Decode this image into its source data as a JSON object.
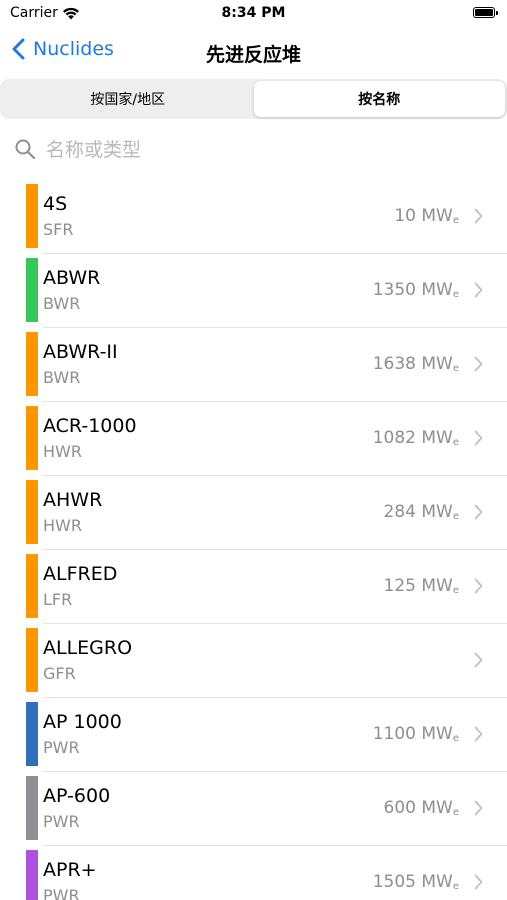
{
  "status_bar": {
    "carrier": "Carrier",
    "time": "8:34 PM"
  },
  "nav": {
    "back_label": "Nuclides",
    "title": "先进反应堆"
  },
  "segments": [
    {
      "label": "按国家/地区",
      "selected": false
    },
    {
      "label": "按名称",
      "selected": true
    }
  ],
  "search": {
    "placeholder": "名称或类型",
    "value": ""
  },
  "colors": {
    "accent": "#1f7ae0",
    "SFR": "#ff9500",
    "BWR": "#34c759",
    "HWR": "#ff9500",
    "LFR": "#ff9500",
    "GFR": "#ff9500",
    "PWR_blue": "#2f70b8",
    "PWR_gray": "#8e8e93",
    "PWR_purple": "#af52de"
  },
  "reactors": [
    {
      "name": "4S",
      "type": "SFR",
      "power": "10 MW",
      "power_sub": "e",
      "color": "#ff9500"
    },
    {
      "name": "ABWR",
      "type": "BWR",
      "power": "1350 MW",
      "power_sub": "e",
      "color": "#34c759"
    },
    {
      "name": "ABWR-II",
      "type": "BWR",
      "power": "1638 MW",
      "power_sub": "e",
      "color": "#ff9500"
    },
    {
      "name": "ACR-1000",
      "type": "HWR",
      "power": "1082 MW",
      "power_sub": "e",
      "color": "#ff9500"
    },
    {
      "name": "AHWR",
      "type": "HWR",
      "power": "284 MW",
      "power_sub": "e",
      "color": "#ff9500"
    },
    {
      "name": "ALFRED",
      "type": "LFR",
      "power": "125 MW",
      "power_sub": "e",
      "color": "#ff9500"
    },
    {
      "name": "ALLEGRO",
      "type": "GFR",
      "power": "",
      "power_sub": "",
      "color": "#ff9500"
    },
    {
      "name": "AP 1000",
      "type": "PWR",
      "power": "1100 MW",
      "power_sub": "e",
      "color": "#2f70b8"
    },
    {
      "name": "AP-600",
      "type": "PWR",
      "power": "600 MW",
      "power_sub": "e",
      "color": "#8e8e93"
    },
    {
      "name": "APR+",
      "type": "PWR",
      "power": "1505 MW",
      "power_sub": "e",
      "color": "#af52de"
    }
  ]
}
